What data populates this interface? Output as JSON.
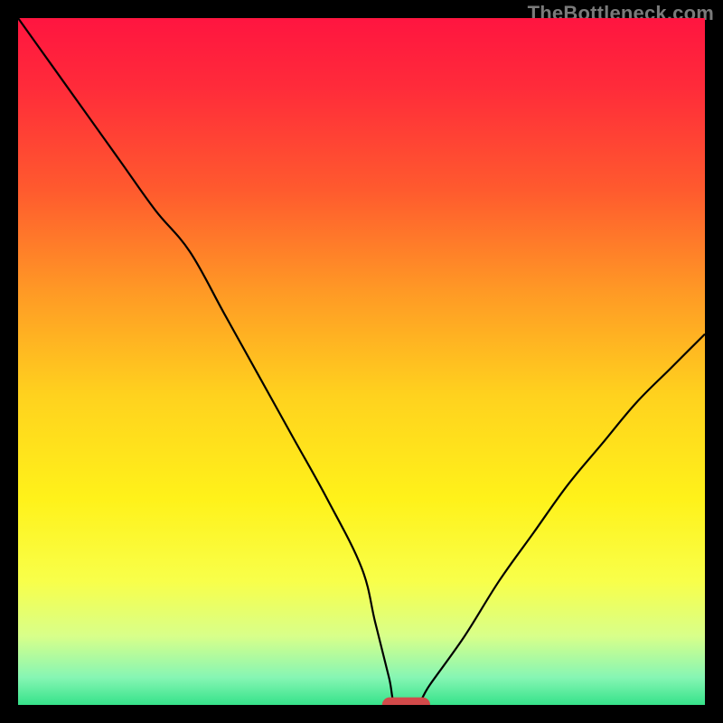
{
  "watermark": "TheBottleneck.com",
  "chart_data": {
    "type": "line",
    "title": "",
    "xlabel": "",
    "ylabel": "",
    "xlim": [
      0,
      100
    ],
    "ylim": [
      0,
      100
    ],
    "x": [
      0,
      5,
      10,
      15,
      20,
      25,
      30,
      35,
      40,
      45,
      50,
      52,
      54,
      55,
      58,
      60,
      65,
      70,
      75,
      80,
      85,
      90,
      95,
      100
    ],
    "values": [
      100,
      93,
      86,
      79,
      72,
      66,
      57,
      48,
      39,
      30,
      20,
      12,
      4,
      0,
      0,
      3,
      10,
      18,
      25,
      32,
      38,
      44,
      49,
      54
    ],
    "curve_color": "#000000",
    "background_gradient": {
      "stops": [
        {
          "offset": 0.0,
          "color": "#ff1540"
        },
        {
          "offset": 0.1,
          "color": "#ff2b3a"
        },
        {
          "offset": 0.25,
          "color": "#ff5a2e"
        },
        {
          "offset": 0.4,
          "color": "#ff9a25"
        },
        {
          "offset": 0.55,
          "color": "#ffd21e"
        },
        {
          "offset": 0.7,
          "color": "#fff21a"
        },
        {
          "offset": 0.82,
          "color": "#f8ff4a"
        },
        {
          "offset": 0.9,
          "color": "#d8ff8a"
        },
        {
          "offset": 0.96,
          "color": "#86f6b4"
        },
        {
          "offset": 1.0,
          "color": "#36e28a"
        }
      ]
    },
    "marker": {
      "x_center": 56.5,
      "y_center": 0,
      "width": 7,
      "height": 2.2,
      "rx": 1.1,
      "color": "#d24a4a"
    }
  }
}
